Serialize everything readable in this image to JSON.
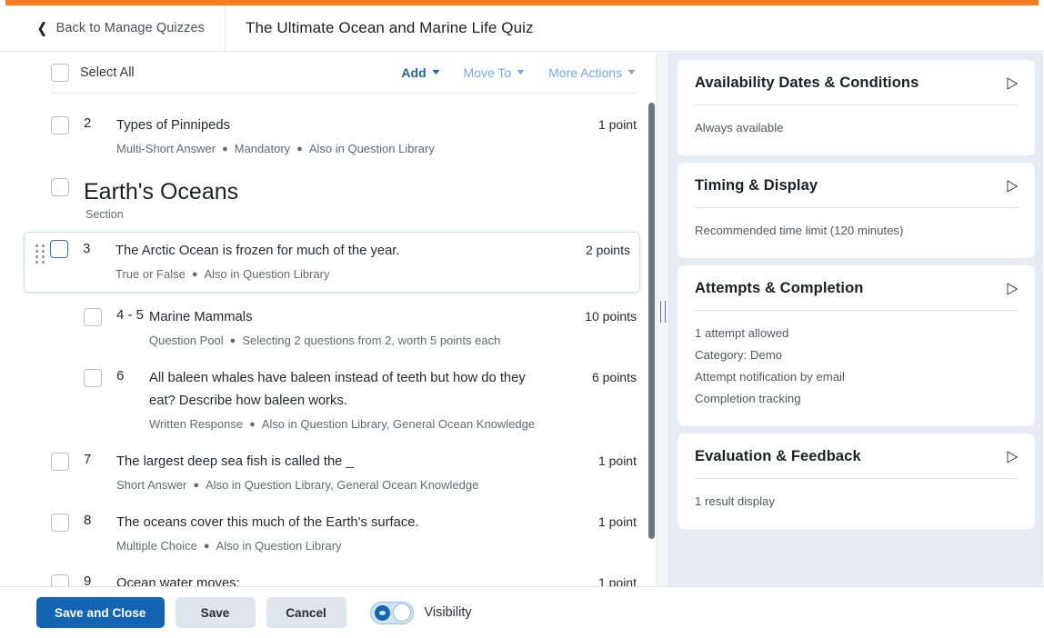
{
  "theme": {
    "accent_orange": "#F47B20",
    "primary_blue": "#1464B4",
    "link_blue": "#1C63AE",
    "muted_link_blue": "#79A8DD",
    "sidebar_bg": "#E7EBF3"
  },
  "header": {
    "back_label": "Back to Manage Quizzes",
    "back_icon": "chevron-left-icon",
    "quiz_title": "The Ultimate Ocean and Marine Life Quiz"
  },
  "toolbar": {
    "select_all_label": "Select All",
    "actions": [
      {
        "label": "Add",
        "state": "primary",
        "caret": "chevron-down-icon"
      },
      {
        "label": "Move To",
        "state": "muted",
        "caret": "chevron-down-icon"
      },
      {
        "label": "More Actions",
        "state": "muted",
        "caret": "chevron-down-icon"
      }
    ]
  },
  "questions": [
    {
      "kind": "question",
      "number": "2",
      "title": "Types of Pinnipeds",
      "meta": [
        "Multi-Short Answer",
        "Mandatory",
        "Also in Question Library"
      ],
      "points": "1 point",
      "selected": false,
      "indented": false
    },
    {
      "kind": "section",
      "title": "Earth's Oceans",
      "subtitle": "Section"
    },
    {
      "kind": "question",
      "number": "3",
      "title": "The Arctic Ocean is frozen for much of the year.",
      "meta": [
        "True or False",
        "Also in Question Library"
      ],
      "points": "2 points",
      "selected": true,
      "indented": false,
      "drag_handle": "drag-handle-icon"
    },
    {
      "kind": "question",
      "number": "4 - 5",
      "title": "Marine Mammals",
      "meta": [
        "Question Pool",
        "Selecting 2 questions from 2, worth 5 points each"
      ],
      "points": "10 points",
      "selected": false,
      "indented": true
    },
    {
      "kind": "question",
      "number": "6",
      "title": "All baleen whales have baleen instead of teeth but how do they eat? Describe how baleen works.",
      "meta": [
        "Written Response",
        "Also in Question Library, General Ocean Knowledge"
      ],
      "points": "6 points",
      "selected": false,
      "indented": true
    },
    {
      "kind": "question",
      "number": "7",
      "title": "The largest deep sea fish is called the _",
      "meta": [
        "Short Answer",
        "Also in Question Library, General Ocean Knowledge"
      ],
      "points": "1 point",
      "selected": false,
      "indented": false
    },
    {
      "kind": "question",
      "number": "8",
      "title": "The oceans cover this much of the Earth's surface.",
      "meta": [
        "Multiple Choice",
        "Also in Question Library"
      ],
      "points": "1 point",
      "selected": false,
      "indented": false
    },
    {
      "kind": "question",
      "number": "9",
      "title": "Ocean water moves:",
      "meta": [],
      "points": "1 point",
      "selected": false,
      "indented": false
    }
  ],
  "sidebar": {
    "panels": [
      {
        "title": "Availability Dates & Conditions",
        "caret": "chevron-right-icon",
        "lines": [
          "Always available"
        ]
      },
      {
        "title": "Timing & Display",
        "caret": "chevron-right-icon",
        "lines": [
          "Recommended time limit (120 minutes)"
        ]
      },
      {
        "title": "Attempts & Completion",
        "caret": "chevron-right-icon",
        "lines": [
          "1 attempt allowed",
          "Category: Demo",
          "Attempt notification by email",
          "Completion tracking"
        ]
      },
      {
        "title": "Evaluation & Feedback",
        "caret": "chevron-right-icon",
        "lines": [
          "1 result display"
        ]
      }
    ]
  },
  "footer": {
    "save_and_close_label": "Save and Close",
    "save_label": "Save",
    "cancel_label": "Cancel",
    "visibility_label": "Visibility",
    "visibility_on": true,
    "visibility_icon": "eye-icon"
  }
}
